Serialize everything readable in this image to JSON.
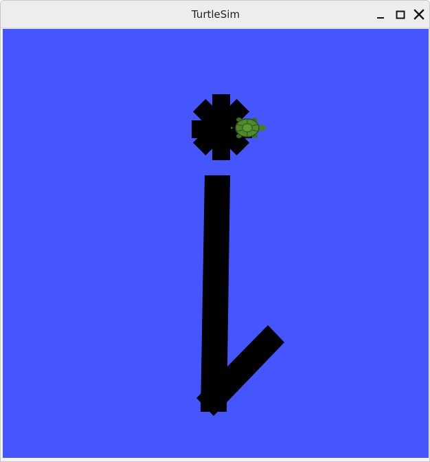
{
  "window": {
    "title": "TurtleSim",
    "controls": {
      "minimize": "minimize-icon",
      "maximize": "maximize-icon",
      "close": "close-icon"
    }
  },
  "canvas": {
    "background_color": "#4556ff",
    "pen_color": "#000000"
  },
  "turtle": {
    "icon": "turtle-icon",
    "shell_color": "#4c8a2a",
    "heading": "east"
  }
}
